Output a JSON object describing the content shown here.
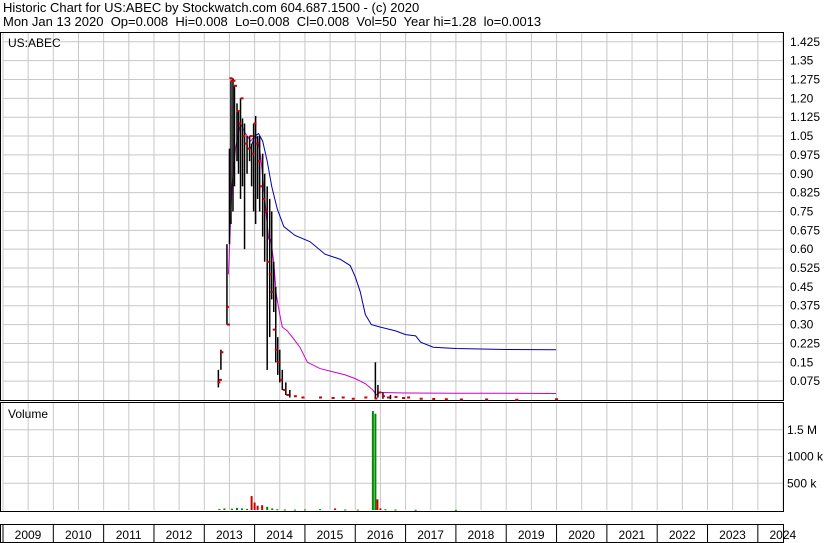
{
  "header": {
    "line1": "Historic Chart for US:ABEC by Stockwatch.com 604.687.1500 - (c) 2020",
    "line2": "Mon Jan 13 2020  Op=0.008  Hi=0.008  Lo=0.008  Cl=0.008  Vol=50  Year hi=1.28  lo=0.0013"
  },
  "colors": {
    "grid": "#c8c8c8",
    "price": "#000000",
    "price_dots": "#cc0000",
    "ma_long": "#0000aa",
    "ma_short": "#cc00cc",
    "volume_up": "#008800",
    "volume_down": "#cc0000"
  },
  "chart_data": [
    {
      "type": "line",
      "title": "US:ABEC",
      "x_unit": "year",
      "xlim": [
        2009,
        2024.5
      ],
      "ylim": [
        0,
        1.46
      ],
      "y_ticks": [
        0.075,
        0.15,
        0.225,
        0.3,
        0.375,
        0.45,
        0.525,
        0.6,
        0.675,
        0.75,
        0.825,
        0.9,
        0.975,
        1.05,
        1.125,
        1.2,
        1.275,
        1.35,
        1.425
      ],
      "y_tick_labels": [
        "0.075",
        "0.15",
        "0.225",
        "0.30",
        "0.375",
        "0.45",
        "0.525",
        "0.60",
        "0.675",
        "0.75",
        "0.825",
        "0.90",
        "0.975",
        "1.05",
        "1.125",
        "1.20",
        "1.275",
        "1.35",
        "1.425"
      ],
      "grid": true,
      "series": [
        {
          "role": "price_hl",
          "points": [
            [
              2013.28,
              0.05,
              0.12
            ],
            [
              2013.33,
              0.12,
              0.2
            ],
            [
              2013.45,
              0.3,
              0.62
            ],
            [
              2013.5,
              0.62,
              1.0
            ],
            [
              2013.53,
              0.7,
              1.27
            ],
            [
              2013.57,
              0.75,
              1.28
            ],
            [
              2013.6,
              0.85,
              1.25
            ],
            [
              2013.65,
              0.95,
              1.18
            ],
            [
              2013.68,
              0.9,
              1.15
            ],
            [
              2013.72,
              0.8,
              1.2
            ],
            [
              2013.76,
              0.85,
              1.12
            ],
            [
              2013.8,
              0.6,
              1.1
            ],
            [
              2013.85,
              0.9,
              1.05
            ],
            [
              2013.9,
              0.95,
              1.05
            ],
            [
              2013.94,
              0.85,
              1.02
            ],
            [
              2013.98,
              0.75,
              1.1
            ],
            [
              2014.02,
              0.7,
              1.13
            ],
            [
              2014.06,
              0.8,
              1.05
            ],
            [
              2014.1,
              0.75,
              1.05
            ],
            [
              2014.16,
              0.65,
              0.98
            ],
            [
              2014.2,
              0.55,
              0.9
            ],
            [
              2014.25,
              0.12,
              0.85
            ],
            [
              2014.3,
              0.25,
              0.8
            ],
            [
              2014.34,
              0.4,
              0.75
            ],
            [
              2014.38,
              0.35,
              0.55
            ],
            [
              2014.42,
              0.15,
              0.45
            ],
            [
              2014.46,
              0.1,
              0.25
            ],
            [
              2014.5,
              0.07,
              0.2
            ],
            [
              2014.55,
              0.04,
              0.12
            ],
            [
              2014.62,
              0.02,
              0.07
            ],
            [
              2014.7,
              0.01,
              0.04
            ],
            [
              2016.4,
              0.005,
              0.15
            ],
            [
              2016.45,
              0.01,
              0.06
            ],
            [
              2016.55,
              0.005,
              0.03
            ],
            [
              2016.7,
              0.003,
              0.02
            ]
          ]
        },
        {
          "role": "price_dots",
          "points": [
            [
              2013.28,
              0.07
            ],
            [
              2013.31,
              0.08
            ],
            [
              2013.34,
              0.19
            ],
            [
              2013.45,
              0.37
            ],
            [
              2013.47,
              0.3
            ],
            [
              2013.52,
              1.28
            ],
            [
              2013.54,
              1.27
            ],
            [
              2013.58,
              1.27
            ],
            [
              2013.61,
              1.25
            ],
            [
              2013.66,
              1.15
            ],
            [
              2013.7,
              1.1
            ],
            [
              2013.74,
              1.2
            ],
            [
              2013.78,
              1.05
            ],
            [
              2013.82,
              1.02
            ],
            [
              2013.88,
              1.0
            ],
            [
              2013.92,
              1.05
            ],
            [
              2013.96,
              0.98
            ],
            [
              2014.0,
              1.1
            ],
            [
              2014.04,
              1.02
            ],
            [
              2014.08,
              0.95
            ],
            [
              2014.12,
              0.85
            ],
            [
              2014.18,
              0.8
            ],
            [
              2014.22,
              0.75
            ],
            [
              2014.26,
              0.55
            ],
            [
              2014.3,
              0.5
            ],
            [
              2014.34,
              0.43
            ],
            [
              2014.38,
              0.28
            ],
            [
              2014.42,
              0.2
            ],
            [
              2014.46,
              0.15
            ],
            [
              2014.52,
              0.08
            ],
            [
              2014.58,
              0.04
            ],
            [
              2014.65,
              0.02
            ],
            [
              2014.8,
              0.015
            ],
            [
              2014.95,
              0.01
            ],
            [
              2015.3,
              0.01
            ],
            [
              2015.55,
              0.008
            ],
            [
              2015.75,
              0.01
            ],
            [
              2015.95,
              0.005
            ],
            [
              2016.2,
              0.01
            ],
            [
              2016.4,
              0.006
            ],
            [
              2016.48,
              0.03
            ],
            [
              2016.55,
              0.015
            ],
            [
              2016.65,
              0.01
            ],
            [
              2016.8,
              0.012
            ],
            [
              2016.95,
              0.008
            ],
            [
              2017.05,
              0.01
            ],
            [
              2017.3,
              0.005
            ],
            [
              2017.55,
              0.004
            ],
            [
              2017.8,
              0.003
            ],
            [
              2018.1,
              0.002
            ],
            [
              2018.6,
              0.002
            ],
            [
              2019.2,
              0.001
            ],
            [
              2019.99,
              0.003
            ]
          ]
        },
        {
          "role": "ma_long",
          "points": [
            [
              2013.92,
              1.0
            ],
            [
              2014.0,
              1.05
            ],
            [
              2014.08,
              1.06
            ],
            [
              2014.16,
              1.03
            ],
            [
              2014.25,
              0.95
            ],
            [
              2014.34,
              0.85
            ],
            [
              2014.45,
              0.76
            ],
            [
              2014.58,
              0.69
            ],
            [
              2014.8,
              0.655
            ],
            [
              2015.1,
              0.63
            ],
            [
              2015.4,
              0.58
            ],
            [
              2015.7,
              0.56
            ],
            [
              2015.9,
              0.535
            ],
            [
              2016.0,
              0.49
            ],
            [
              2016.1,
              0.43
            ],
            [
              2016.2,
              0.34
            ],
            [
              2016.32,
              0.3
            ],
            [
              2016.5,
              0.29
            ],
            [
              2016.8,
              0.275
            ],
            [
              2017.0,
              0.26
            ],
            [
              2017.2,
              0.255
            ],
            [
              2017.3,
              0.23
            ],
            [
              2017.55,
              0.21
            ],
            [
              2018.0,
              0.205
            ],
            [
              2018.5,
              0.203
            ],
            [
              2019.0,
              0.201
            ],
            [
              2019.99,
              0.2
            ]
          ]
        },
        {
          "role": "ma_short",
          "points": [
            [
              2013.48,
              0.5
            ],
            [
              2013.55,
              0.85
            ],
            [
              2013.62,
              1.0
            ],
            [
              2013.72,
              1.1
            ],
            [
              2013.82,
              1.06
            ],
            [
              2013.92,
              1.03
            ],
            [
              2014.0,
              1.05
            ],
            [
              2014.06,
              1.04
            ],
            [
              2014.12,
              0.97
            ],
            [
              2014.18,
              0.85
            ],
            [
              2014.24,
              0.72
            ],
            [
              2014.28,
              0.64
            ],
            [
              2014.32,
              0.64
            ],
            [
              2014.38,
              0.55
            ],
            [
              2014.43,
              0.42
            ],
            [
              2014.5,
              0.34
            ],
            [
              2014.55,
              0.29
            ],
            [
              2014.65,
              0.275
            ],
            [
              2014.75,
              0.25
            ],
            [
              2014.9,
              0.21
            ],
            [
              2015.05,
              0.15
            ],
            [
              2015.3,
              0.125
            ],
            [
              2015.6,
              0.11
            ],
            [
              2015.8,
              0.1
            ],
            [
              2016.0,
              0.085
            ],
            [
              2016.2,
              0.065
            ],
            [
              2016.35,
              0.04
            ],
            [
              2016.42,
              0.02
            ],
            [
              2016.5,
              0.03
            ],
            [
              2017.0,
              0.028
            ],
            [
              2018.0,
              0.027
            ],
            [
              2019.0,
              0.027
            ],
            [
              2019.99,
              0.026
            ]
          ]
        }
      ]
    },
    {
      "type": "bar",
      "title": "Volume",
      "x_unit": "year",
      "xlim": [
        2009,
        2024.5
      ],
      "ylim": [
        0,
        2000000
      ],
      "y_ticks": [
        500000,
        1000000,
        1500000
      ],
      "y_tick_labels": [
        "500 k",
        "1000 k",
        "1.5 M"
      ],
      "grid": true,
      "bars": [
        [
          2013.3,
          20000,
          "up"
        ],
        [
          2013.4,
          30000,
          "up"
        ],
        [
          2013.55,
          25000,
          "up"
        ],
        [
          2013.65,
          40000,
          "up"
        ],
        [
          2013.75,
          30000,
          "up"
        ],
        [
          2013.85,
          20000,
          "up"
        ],
        [
          2013.94,
          260000,
          "down"
        ],
        [
          2014.0,
          140000,
          "down"
        ],
        [
          2014.06,
          80000,
          "down"
        ],
        [
          2014.15,
          90000,
          "down"
        ],
        [
          2014.25,
          60000,
          "up"
        ],
        [
          2014.35,
          30000,
          "up"
        ],
        [
          2014.45,
          15000,
          "up"
        ],
        [
          2014.6,
          10000,
          "up"
        ],
        [
          2014.8,
          8000,
          "up"
        ],
        [
          2015.0,
          10000,
          "up"
        ],
        [
          2015.3,
          15000,
          "up"
        ],
        [
          2015.6,
          30000,
          "down"
        ],
        [
          2015.8,
          10000,
          "up"
        ],
        [
          2016.05,
          8000,
          "up"
        ],
        [
          2016.35,
          1850000,
          "up"
        ],
        [
          2016.4,
          1800000,
          "up"
        ],
        [
          2016.44,
          200000,
          "down"
        ],
        [
          2016.5,
          30000,
          "down"
        ],
        [
          2016.6,
          15000,
          "up"
        ],
        [
          2016.8,
          10000,
          "up"
        ],
        [
          2017.2,
          5000,
          "up"
        ],
        [
          2018.0,
          3000,
          "up"
        ]
      ]
    }
  ],
  "x_axis": {
    "labels": [
      "2009",
      "2010",
      "2011",
      "2012",
      "2013",
      "2014",
      "2015",
      "2016",
      "2017",
      "2018",
      "2019",
      "2020",
      "2021",
      "2022",
      "2023",
      "2024"
    ]
  }
}
